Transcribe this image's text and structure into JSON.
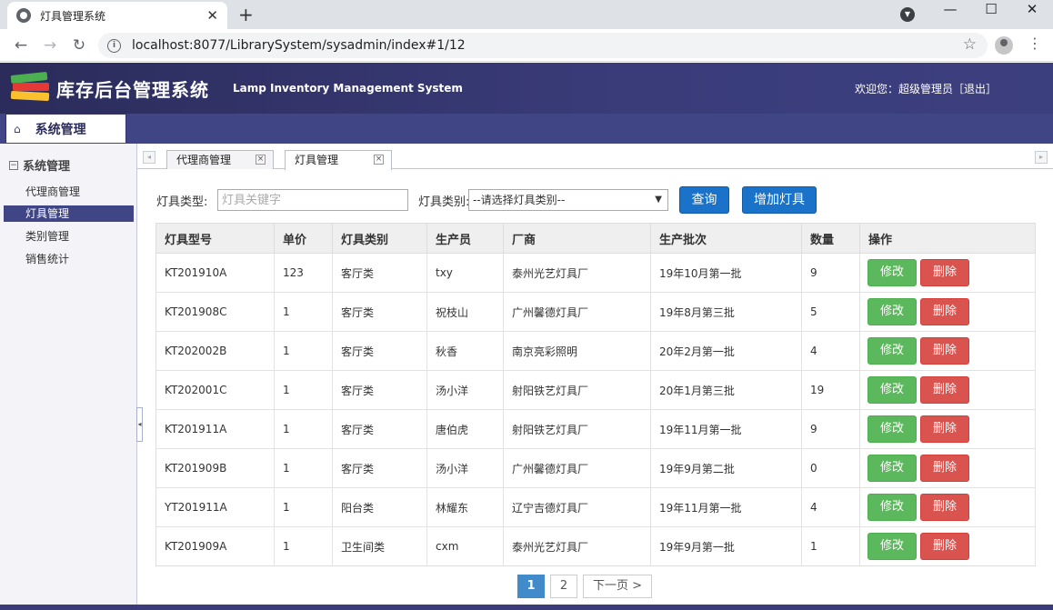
{
  "browser": {
    "tab_title": "灯具管理系统",
    "url": "localhost:8077/LibrarySystem/sysadmin/index#1/12"
  },
  "header": {
    "title": "库存后台管理系统",
    "subtitle": "Lamp Inventory Management System",
    "welcome": "欢迎您：超级管理员［退出］"
  },
  "menubar": {
    "tab_label": "系统管理"
  },
  "sidebar": {
    "section": "系统管理",
    "items": [
      {
        "label": "代理商管理"
      },
      {
        "label": "灯具管理"
      },
      {
        "label": "类别管理"
      },
      {
        "label": "销售统计"
      }
    ]
  },
  "content_tabs": [
    {
      "label": "代理商管理"
    },
    {
      "label": "灯具管理"
    }
  ],
  "search": {
    "model_label": "灯具类型:",
    "model_placeholder": "灯具关键字",
    "category_label": "灯具类别:",
    "category_value": "--请选择灯具类别--",
    "query_button": "查询",
    "add_button": "增加灯具"
  },
  "table": {
    "headers": [
      "灯具型号",
      "单价",
      "灯具类别",
      "生产员",
      "厂商",
      "生产批次",
      "数量",
      "操作"
    ],
    "edit_label": "修改",
    "delete_label": "删除",
    "rows": [
      [
        "KT201910A",
        "123",
        "客厅类",
        "txy",
        "泰州光艺灯具厂",
        "19年10月第一批",
        "9"
      ],
      [
        "KT201908C",
        "1",
        "客厅类",
        "祝枝山",
        "广州馨德灯具厂",
        "19年8月第三批",
        "5"
      ],
      [
        "KT202002B",
        "1",
        "客厅类",
        "秋香",
        "南京亮彩照明",
        "20年2月第一批",
        "4"
      ],
      [
        "KT202001C",
        "1",
        "客厅类",
        "汤小洋",
        "射阳铁艺灯具厂",
        "20年1月第三批",
        "19"
      ],
      [
        "KT201911A",
        "1",
        "客厅类",
        "唐伯虎",
        "射阳铁艺灯具厂",
        "19年11月第一批",
        "9"
      ],
      [
        "KT201909B",
        "1",
        "客厅类",
        "汤小洋",
        "广州馨德灯具厂",
        "19年9月第二批",
        "0"
      ],
      [
        "YT201911A",
        "1",
        "阳台类",
        "林耀东",
        "辽宁吉德灯具厂",
        "19年11月第一批",
        "4"
      ],
      [
        "KT201909A",
        "1",
        "卫生间类",
        "cxm",
        "泰州光艺灯具厂",
        "19年9月第一批",
        "1"
      ]
    ]
  },
  "pagination": {
    "pages": [
      "1",
      "2"
    ],
    "current": "1",
    "next_label": "下一页 >"
  },
  "colors": {
    "header_bg": "#2b2c5b",
    "menubar_bg": "#3f4585",
    "primary_button": "#1a72c9",
    "edit_button": "#5cb85c",
    "delete_button": "#d9534f",
    "pager_active": "#428bca"
  }
}
